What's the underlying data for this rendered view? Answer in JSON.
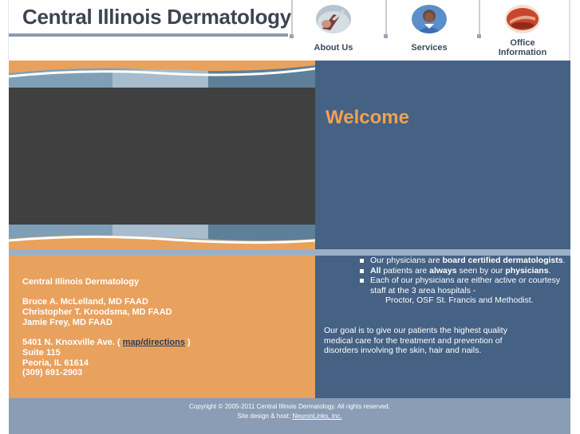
{
  "header": {
    "site_title": "Central Illinois Dermatology",
    "nav": [
      {
        "label": "About Us",
        "icon": "doctor-photo-icon"
      },
      {
        "label": "Services",
        "icon": "nurse-photo-icon"
      },
      {
        "label": "Office Information",
        "label_line1": "Office",
        "label_line2": "Information",
        "icon": "office-phone-photo-icon"
      }
    ]
  },
  "main": {
    "welcome_heading": "Welcome",
    "features": [
      {
        "parts": [
          "Our physicians are ",
          "board certified dermatologists",
          "."
        ]
      },
      {
        "parts": [
          "All",
          " patients are ",
          "always",
          " seen by our ",
          "physicians",
          "."
        ]
      },
      {
        "text": "Each of our physicians are either active or courtesy staff at the 3 area hospitals -",
        "subtext": "Proctor, OSF St. Francis and Methodist."
      }
    ],
    "goal_text": "Our goal is to give our patients the highest quality medical care for the treatment and prevention of disorders involving the skin, hair and nails."
  },
  "contact": {
    "practice_name": "Central Illinois Dermatology",
    "physicians": [
      "Bruce A. McLelland, MD FAAD",
      "Christopher T. Kroodsma, MD FAAD",
      "Jamie Frey, MD FAAD"
    ],
    "address_line1_prefix": "5401 N. Knoxville Ave. ( ",
    "map_link": "map/directions",
    "address_line1_suffix": " )",
    "suite": "Suite 115",
    "city": "Peoria, IL 61614",
    "phone": "(309) 691-2903"
  },
  "footer": {
    "copyright": "Copyright © 2005-2011 Central Illinois Dermatology. All rights reserved.",
    "credit_prefix": "Site design & host: ",
    "credit_link": "NeuronLinks, Inc."
  },
  "colors": {
    "orange_panel": "#e9a15e",
    "blue_panel": "#456184",
    "welcome_orange": "#f0a251",
    "video_gray": "#404040",
    "footer_blue": "#8a9db5"
  }
}
